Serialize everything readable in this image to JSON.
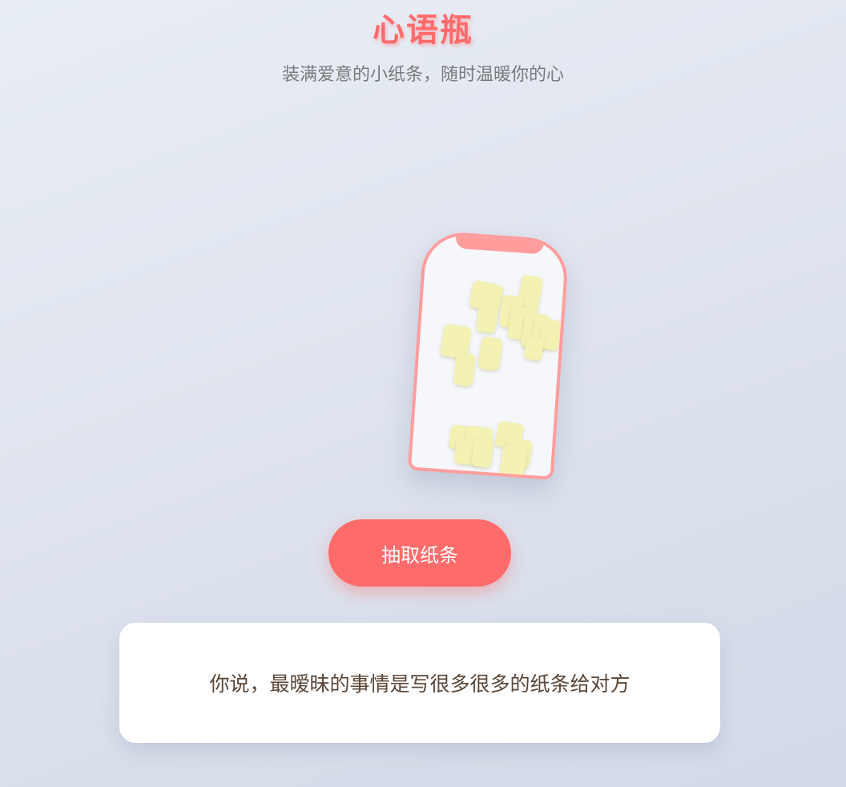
{
  "header": {
    "title": "心语瓶",
    "subtitle": "装满爱意的小纸条，随时温暖你的心"
  },
  "jar": {
    "note_color": "#f4f2b3",
    "border_color": "#ff9d9d"
  },
  "actions": {
    "draw_label": "抽取纸条"
  },
  "message": {
    "text": "你说，最暧昧的事情是写很多很多的纸条给对方"
  },
  "colors": {
    "accent": "#ff6b6b",
    "message_text": "#5b4636"
  }
}
